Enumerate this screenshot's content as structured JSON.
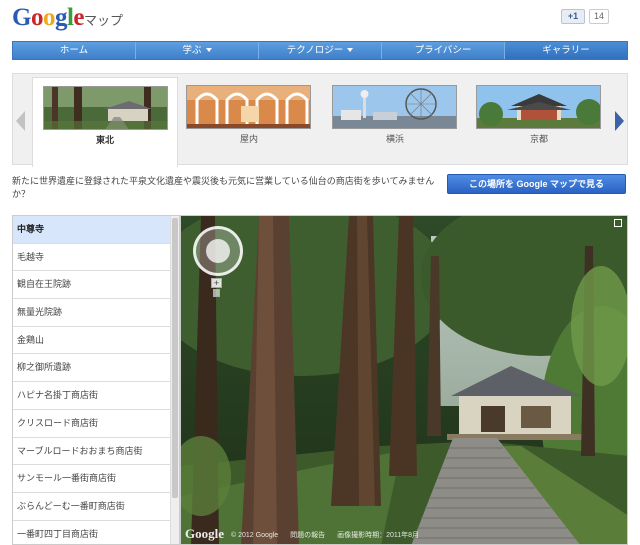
{
  "header": {
    "logo_letters": [
      "G",
      "o",
      "o",
      "g",
      "l",
      "e"
    ],
    "logo_colors": [
      "#2a5ab8",
      "#c9262b",
      "#f0a818",
      "#2a5ab8",
      "#3a9c3c",
      "#c9262b"
    ],
    "product": "マップ",
    "plusone_label": "+1",
    "plusone_count": "14"
  },
  "nav": {
    "items": [
      {
        "label": "ホーム",
        "dropdown": false
      },
      {
        "label": "学ぶ",
        "dropdown": true
      },
      {
        "label": "テクノロジー",
        "dropdown": true
      },
      {
        "label": "プライバシー",
        "dropdown": false
      },
      {
        "label": "ギャラリー",
        "dropdown": false
      }
    ]
  },
  "carousel": {
    "items": [
      {
        "label": "東北",
        "active": true
      },
      {
        "label": "屋内",
        "active": false
      },
      {
        "label": "横浜",
        "active": false
      },
      {
        "label": "京都",
        "active": false
      }
    ]
  },
  "description": "新たに世界遺産に登録された平泉文化遺産や震災後も元気に営業している仙台の商店街を歩いてみませんか？",
  "map_button": "この場所を Google マップで見る",
  "places": [
    "中尊寺",
    "毛越寺",
    "観自在王院跡",
    "無量光院跡",
    "金鶏山",
    "柳之御所遺跡",
    "ハピナ名掛丁商店街",
    "クリスロード商店街",
    "マーブルロードおおまち商店街",
    "サンモール一番街商店街",
    "ぶらんどーむ一番町商店街",
    "一番町四丁目商店街"
  ],
  "streetview": {
    "logo": "Google",
    "copyright": "© 2012 Google",
    "report": "問題の報告",
    "date": "画像撮影時期：2011年8月"
  }
}
